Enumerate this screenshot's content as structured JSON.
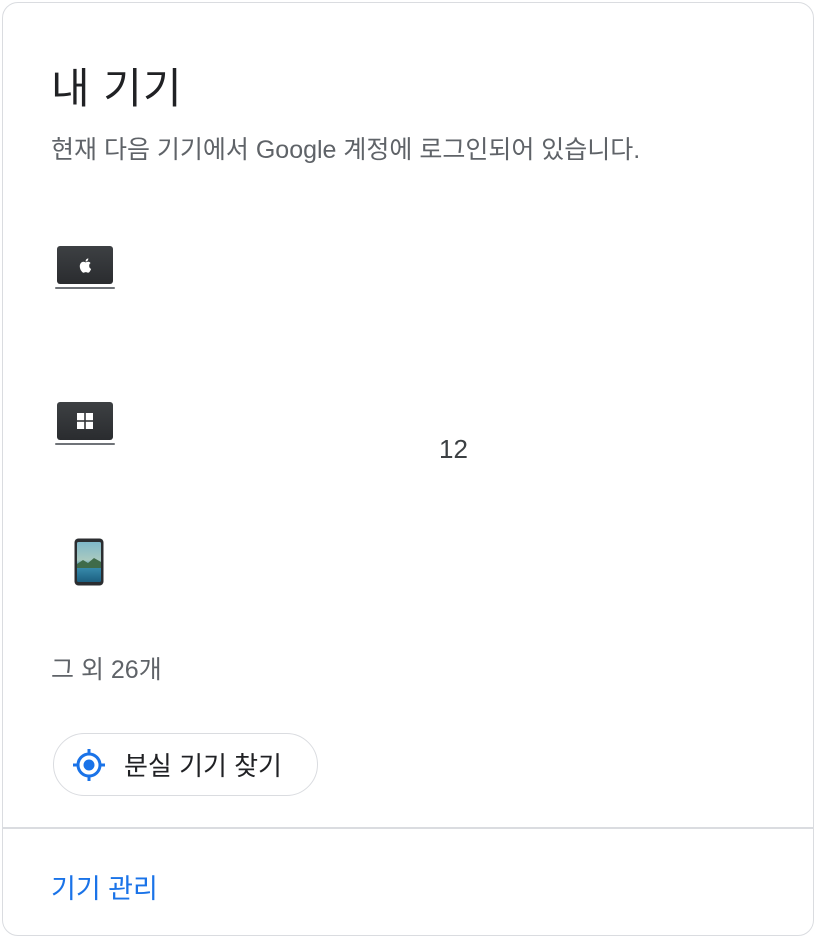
{
  "card": {
    "title": "내 기기",
    "subtitle": "현재 다음 기기에서 Google 계정에 로그인되어 있습니다."
  },
  "devices": [
    {
      "icon": "mac-laptop-icon"
    },
    {
      "icon": "windows-laptop-icon"
    },
    {
      "icon": "android-phone-icon"
    }
  ],
  "middle_value": "12",
  "others_text": "그 외 26개",
  "find_device_button": {
    "label": "분실 기기 찾기",
    "icon": "location-target-icon"
  },
  "manage_link": {
    "label": "기기 관리"
  },
  "colors": {
    "accent": "#1a73e8",
    "border": "#dadce0",
    "text_primary": "#202124",
    "text_secondary": "#5f6368"
  }
}
